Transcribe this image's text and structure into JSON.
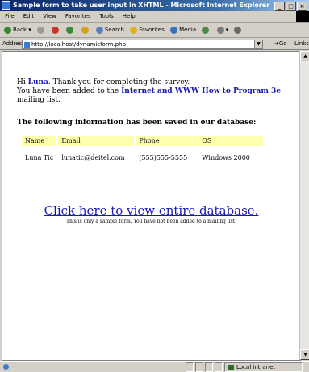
{
  "window": {
    "title": "Sample form to take user input in XHTML - Microsoft Internet Explorer",
    "controls": [
      "_",
      "□",
      "×"
    ]
  },
  "menubar": [
    "File",
    "Edit",
    "View",
    "Favorites",
    "Tools",
    "Help"
  ],
  "toolbar": {
    "back": "Back",
    "search": "Search",
    "favorites": "Favorites",
    "media": "Media"
  },
  "address": {
    "label": "Address",
    "url": "http://localhost/dynamicform.php",
    "go": "Go",
    "links": "Links"
  },
  "content": {
    "greeting_prefix": "Hi",
    "name": "Luna",
    "greeting_suffix": ". Thank you for completing the survey.",
    "added_prefix": "You have been added to the",
    "book": "Internet and WWW How to Program 3e",
    "added_suffix": "mailing list.",
    "heading": "The following information has been saved in our database:",
    "table": {
      "headers": [
        "Name",
        "Email",
        "Phone",
        "OS"
      ],
      "rows": [
        [
          "Luna Tic",
          "lunatic@deitel.com",
          "(555)555-5555",
          "Windows 2000"
        ]
      ]
    },
    "link": "Click here to view entire database.",
    "note": "This is only a sample form. You have not been added to a mailing list."
  },
  "status": {
    "zone": "Local intranet"
  },
  "colors": {
    "header_bg": "#ffffb0",
    "link": "#1a1ab0"
  }
}
